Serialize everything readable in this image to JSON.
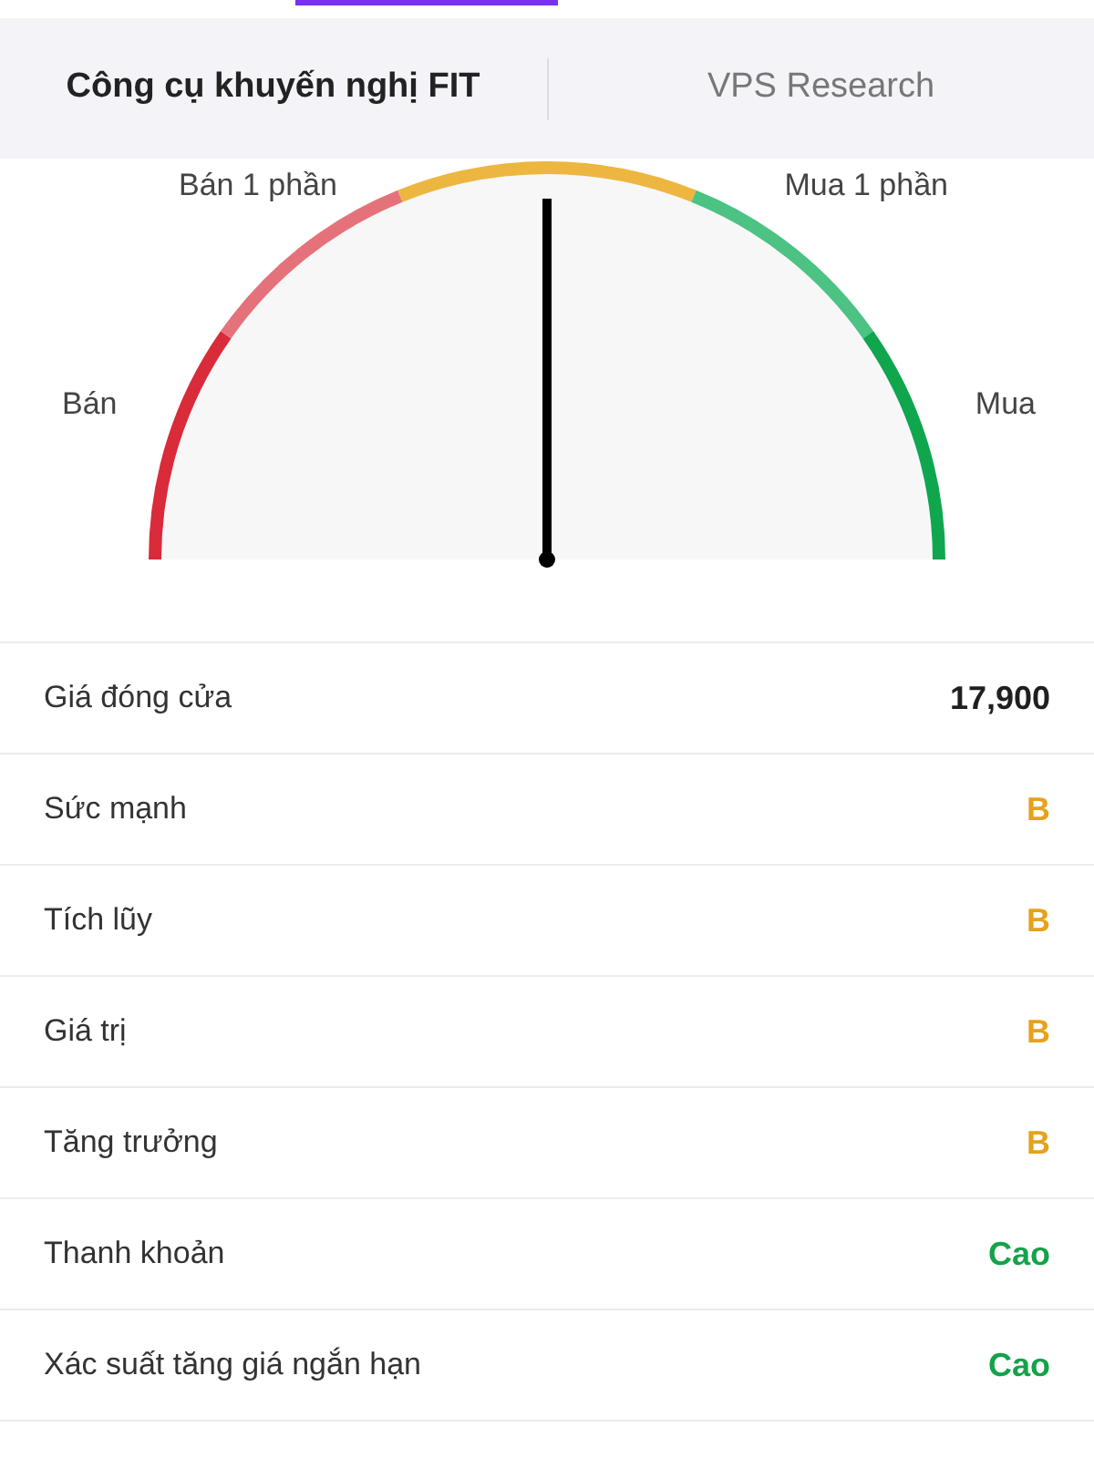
{
  "tabs": [
    {
      "label": "Công cụ khuyến nghị FIT",
      "selected": true
    },
    {
      "label": "VPS Research",
      "selected": false
    }
  ],
  "gauge": {
    "left_label": "Bán",
    "upper_left_label": "Bán 1 phần",
    "upper_right_label": "Mua 1 phần",
    "right_label": "Mua",
    "level": 0.5
  },
  "rows": [
    {
      "label": "Giá đóng cửa",
      "value": "17,900",
      "color": "#1f1f1f"
    },
    {
      "label": "Sức mạnh",
      "value": "B",
      "color": "#e5a21d"
    },
    {
      "label": "Tích lũy",
      "value": "B",
      "color": "#e5a21d"
    },
    {
      "label": "Giá trị",
      "value": "B",
      "color": "#e5a21d"
    },
    {
      "label": "Tăng trưởng",
      "value": "B",
      "color": "#e5a21d"
    },
    {
      "label": "Thanh khoản",
      "value": "Cao",
      "color": "#14a24a"
    },
    {
      "label": "Xác suất tăng giá ngắn hạn",
      "value": "Cao",
      "color": "#14a24a"
    }
  ]
}
